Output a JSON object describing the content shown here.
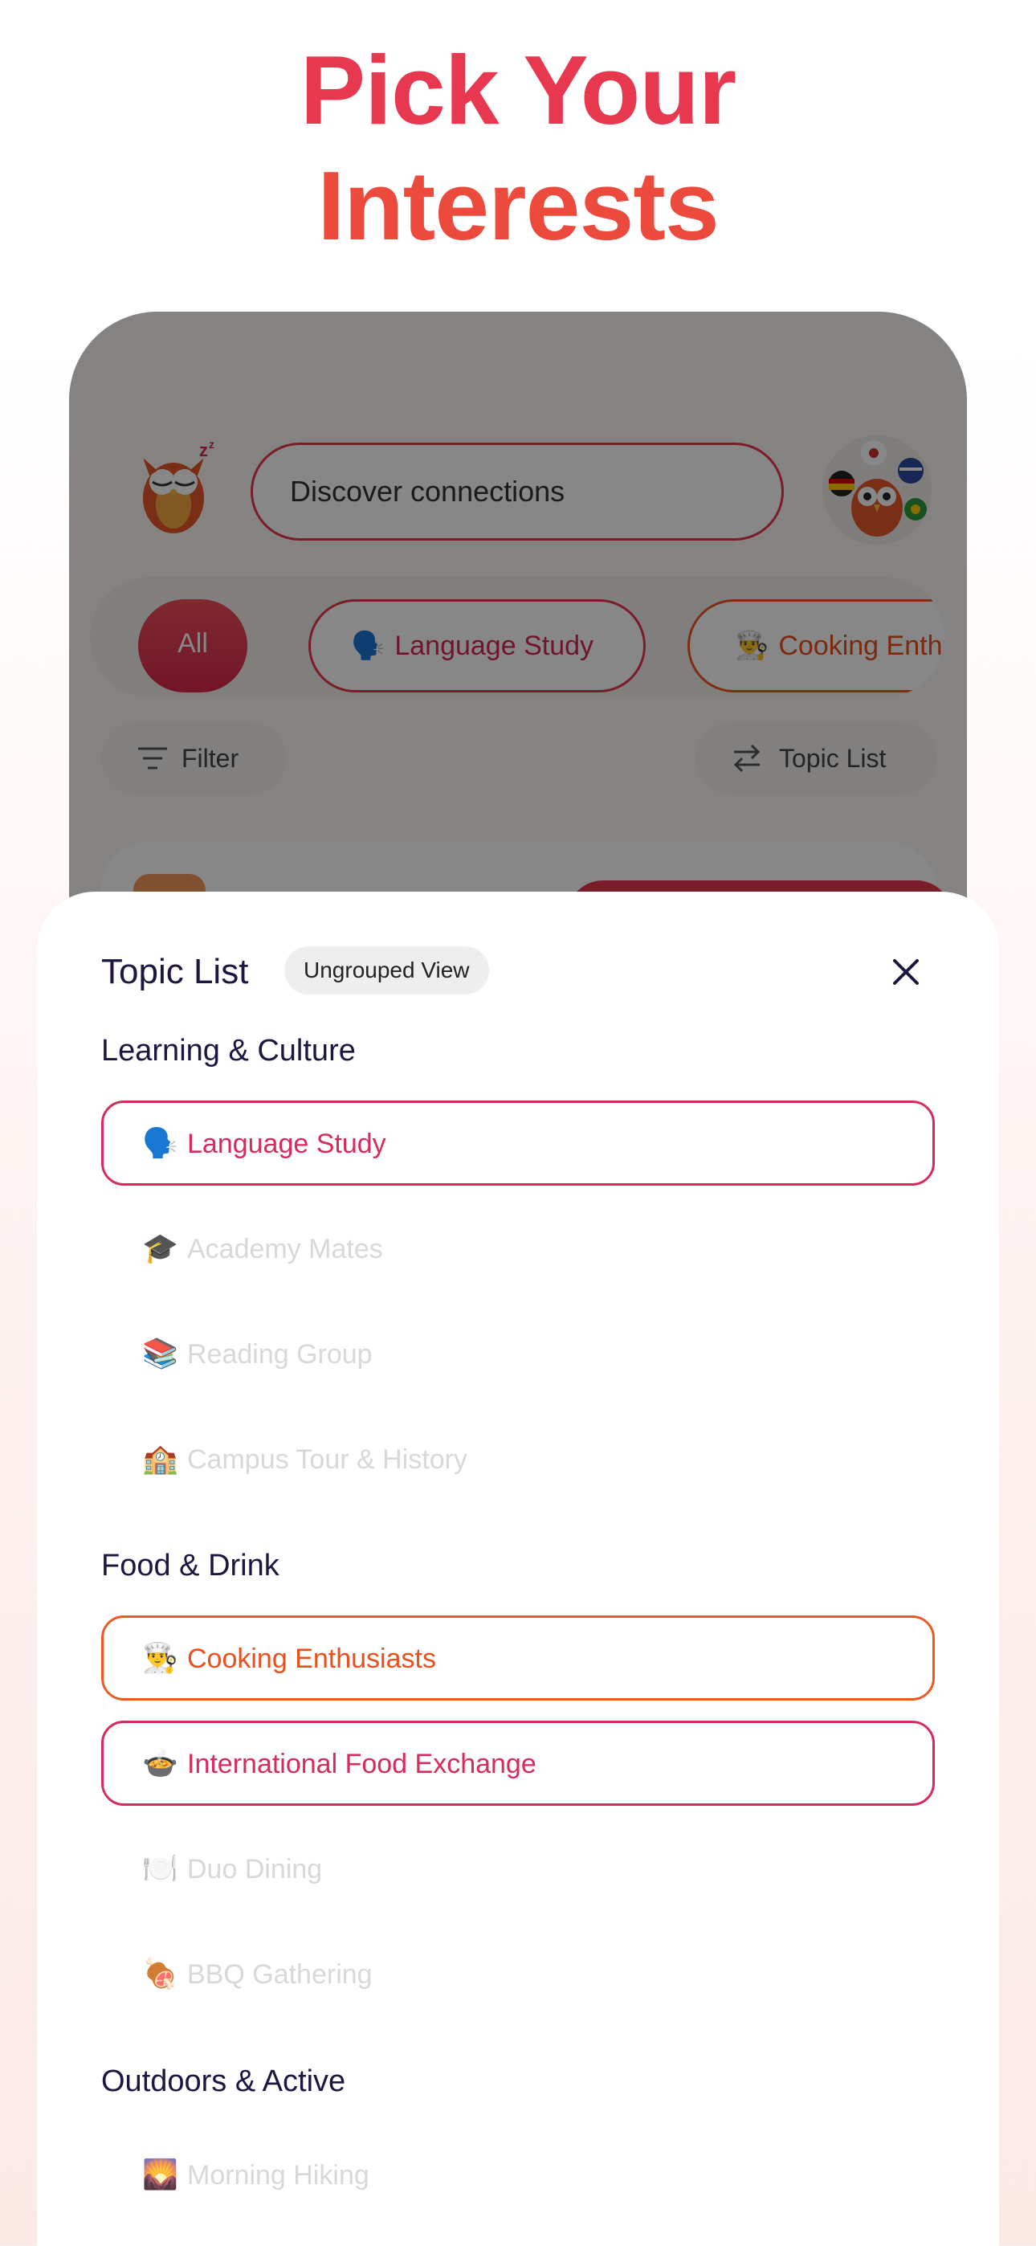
{
  "headline": {
    "line1": "Pick Your",
    "line2": "Interests"
  },
  "colors": {
    "accent_red": "#e8384f",
    "accent_orange": "#ec5a24",
    "heading": "#1a1740",
    "disabled": "#d8d8d8"
  },
  "app": {
    "search": {
      "placeholder": "Discover connections"
    },
    "chips": [
      {
        "label": "All"
      },
      {
        "icon": "🗣️",
        "label": "Language Study"
      },
      {
        "icon": "👨‍🍳",
        "label": "Cooking Enthu"
      }
    ],
    "filter_label": "Filter",
    "topic_list_label": "Topic List"
  },
  "sheet": {
    "title": "Topic List",
    "badge": "Ungrouped View",
    "sections": [
      {
        "title": "Learning & Culture",
        "items": [
          {
            "icon": "🗣️",
            "label": "Language Study",
            "state": "selected"
          },
          {
            "icon": "🎓",
            "label": "Academy Mates",
            "state": "off"
          },
          {
            "icon": "📚",
            "label": "Reading Group",
            "state": "off"
          },
          {
            "icon": "🏫",
            "label": "Campus Tour & History",
            "state": "off"
          }
        ]
      },
      {
        "title": "Food & Drink",
        "items": [
          {
            "icon": "👨‍🍳",
            "label": "Cooking Enthusiasts",
            "state": "selected"
          },
          {
            "icon": "🍲",
            "label": "International Food Exchange",
            "state": "selected"
          },
          {
            "icon": "🍽️",
            "label": "Duo Dining",
            "state": "off"
          },
          {
            "icon": "🍖",
            "label": "BBQ Gathering",
            "state": "off"
          }
        ]
      },
      {
        "title": "Outdoors & Active",
        "items": [
          {
            "icon": "🌄",
            "label": "Morning Hiking",
            "state": "off"
          }
        ]
      }
    ]
  }
}
